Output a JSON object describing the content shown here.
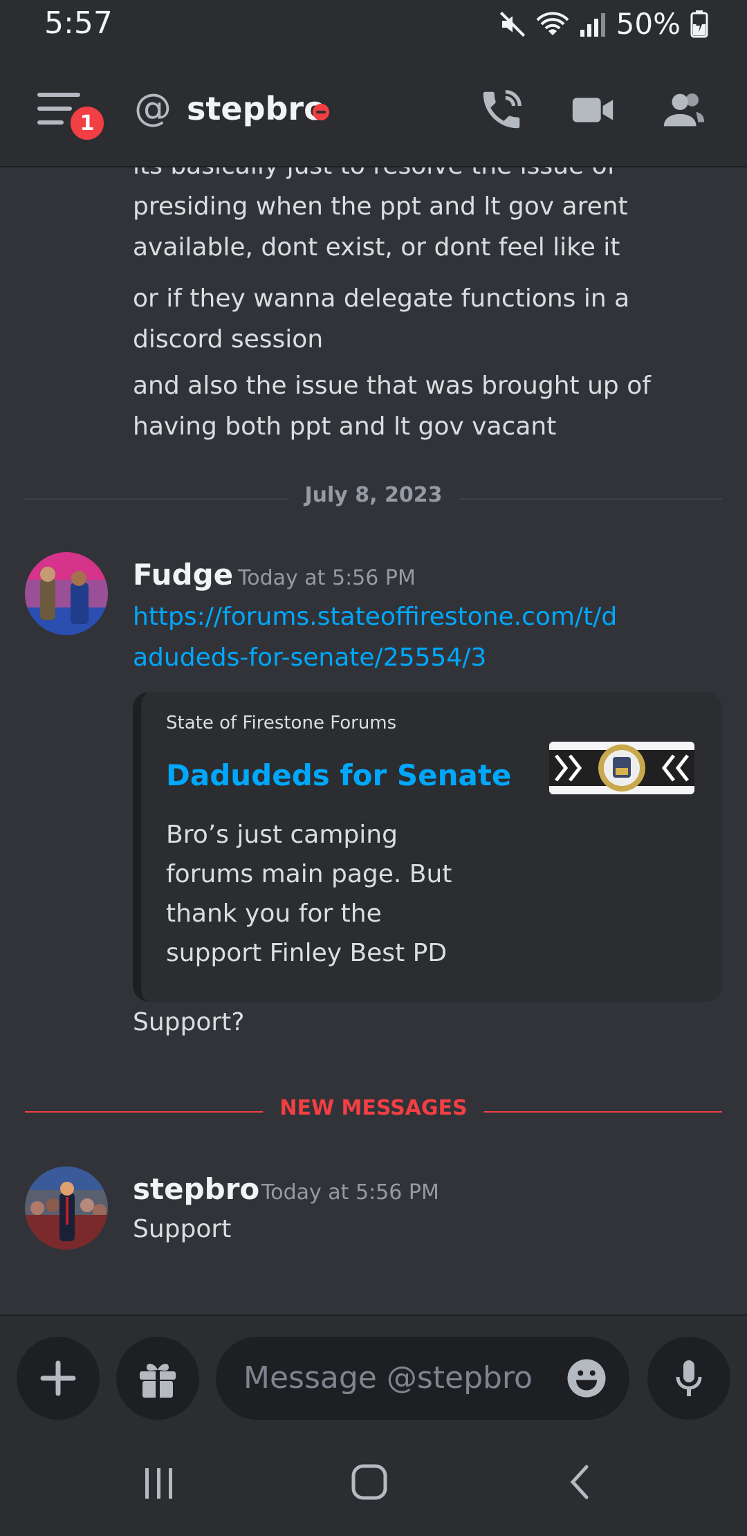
{
  "status_bar": {
    "time": "5:57",
    "battery": "50%"
  },
  "header": {
    "badge_count": "1",
    "at_symbol": "@",
    "channel_name": "stepbro"
  },
  "messages_top": [
    "its basically just to resolve the issue of presiding when the ppt and lt gov arent available, dont exist, or dont feel like it",
    "or if they wanna delegate functions in a discord session",
    "and also the issue that was brought up of having both ppt and lt gov vacant"
  ],
  "date_divider": "July 8, 2023",
  "fudge_message": {
    "username": "Fudge",
    "timestamp": "Today at 5:56 PM",
    "link": "https://forums.stateoffirestone.com/t/dadudeds-for-senate/25554/3",
    "embed": {
      "provider": "State of Firestone Forums",
      "title": "Dadudeds for Senate",
      "description": "Bro’s just camping forums main page. But thank you for the support Finley  Best PD"
    },
    "followup": "Support?"
  },
  "new_messages_label": "NEW MESSAGES",
  "stepbro_message": {
    "username": "stepbro",
    "timestamp": "Today at 5:56 PM",
    "text": "Support"
  },
  "composer": {
    "placeholder": "Message @stepbro"
  },
  "colors": {
    "background": "#313338",
    "link": "#00a8fc",
    "new_messages": "#f23f43",
    "dnd": "#f23f43"
  }
}
